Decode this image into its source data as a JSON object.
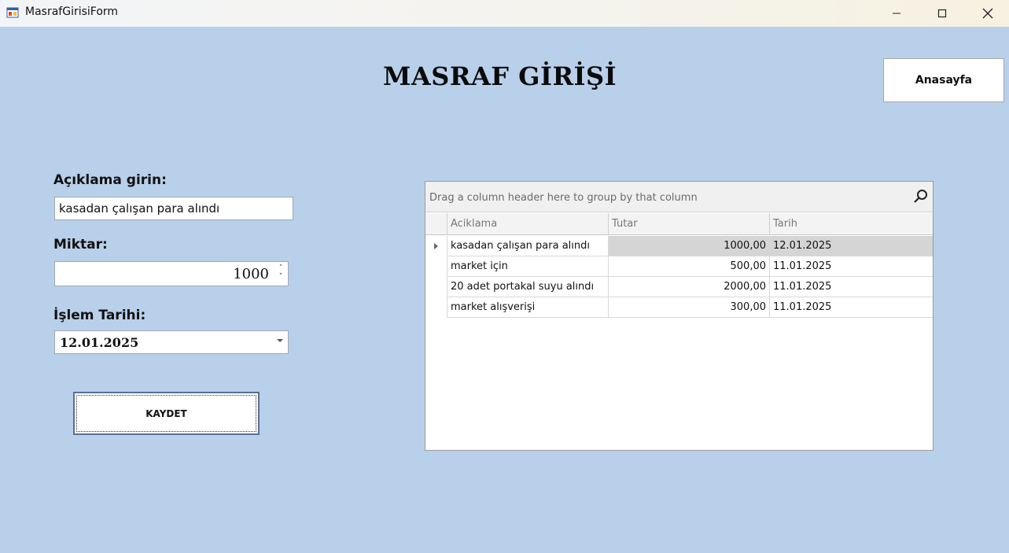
{
  "window": {
    "title": "MasrafGirisiForm",
    "icon": "winforms-app-icon"
  },
  "header": {
    "title": "MASRAF GİRİŞİ",
    "home_button": "Anasayfa"
  },
  "form": {
    "description_label": "Açıklama  girin:",
    "description_value": "kasadan çalışan para alındı",
    "amount_label": "Miktar:",
    "amount_value": "1000",
    "date_label": "İşlem Tarihi:",
    "date_value": "12.01.2025",
    "save_button": "KAYDET"
  },
  "grid": {
    "group_panel_text": "Drag a column header here to group by that column",
    "columns": [
      "Aciklama",
      "Tutar",
      "Tarih"
    ],
    "rows": [
      {
        "aciklama": "kasadan çalışan para alındı",
        "tutar": "1000,00",
        "tarih": "12.01.2025"
      },
      {
        "aciklama": "market için",
        "tutar": "500,00",
        "tarih": "11.01.2025"
      },
      {
        "aciklama": "20 adet portakal suyu alındı",
        "tutar": "2000,00",
        "tarih": "11.01.2025"
      },
      {
        "aciklama": "market alışverişi",
        "tutar": "300,00",
        "tarih": "11.01.2025"
      }
    ]
  },
  "colors": {
    "background": "#b9d0ea",
    "focused_cell": "#d5d5d5"
  }
}
